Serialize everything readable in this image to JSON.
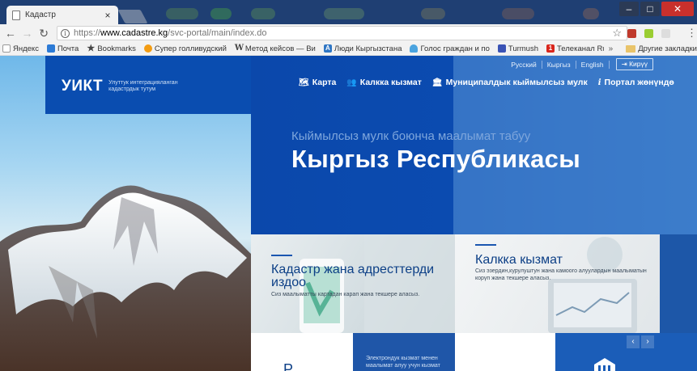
{
  "browser": {
    "tab_title": "Кадастр",
    "tab_close": "×",
    "url_scheme": "https://",
    "url_host": "www.cadastre.kg",
    "url_path": "/svc-portal/main/index.do",
    "window_controls": {
      "minimize": "–",
      "maximize": "□",
      "close": "✕"
    },
    "bookmarks": [
      {
        "label": "Яндекс",
        "icon": "yandex-icon",
        "color": "#ffffff"
      },
      {
        "label": "Почта",
        "icon": "mail-icon",
        "color": "#2d7bd6"
      },
      {
        "label": "Bookmarks",
        "icon": "star-icon",
        "color": "#444444"
      },
      {
        "label": "Супер голливудский",
        "icon": "circle-icon",
        "color": "#f39c12"
      },
      {
        "label": "Метод кейсов — Ви",
        "icon": "wiki-icon",
        "color": "#555555"
      },
      {
        "label": "Люди Кыргызстана",
        "icon": "a-icon",
        "color": "#2f76c4"
      },
      {
        "label": "Голос граждан и по",
        "icon": "cloud-icon",
        "color": "#4aa3df"
      },
      {
        "label": "Turmush",
        "icon": "t-icon",
        "color": "#3a53b5"
      },
      {
        "label": "Телеканал Russia.tv",
        "icon": "one-icon",
        "color": "#d9261c"
      }
    ],
    "bookmarks_more": "»",
    "other_bookmarks": "Другие закладки"
  },
  "site": {
    "logo": "УИКТ",
    "logo_subtitle": "Улуттук интеграцияланган кадастрдык тутум",
    "languages": [
      "Русский",
      "Кыргыз",
      "English"
    ],
    "login": "Кирүү",
    "nav": [
      {
        "label": "Карта",
        "icon": "map-icon"
      },
      {
        "label": "Калкка кызмат",
        "icon": "people-icon"
      },
      {
        "label": "Муниципалдык кыймылсыз мулк",
        "icon": "bank-icon"
      },
      {
        "label": "Портал жөнүндө",
        "icon": "info-icon"
      }
    ],
    "hero_subtitle": "Кыймылсыз мулк боюнча маалымат табуу",
    "hero_title": "Кыргыз Республикасы",
    "cards": [
      {
        "title": "Кадастр жана адресттерди издоо",
        "description": "Сиз маалыматты картадан карап жана текшере аласыз."
      },
      {
        "title": "Калкка кызмат",
        "description": "Сиз эзердин,курулуштун жана камоого алуулардын маалыматын корүп жана текшере аласыз."
      }
    ],
    "bottom_text": "Электрондук кызмат менен маалымат алуу учун кызмат",
    "prev": "‹",
    "next": "›"
  }
}
